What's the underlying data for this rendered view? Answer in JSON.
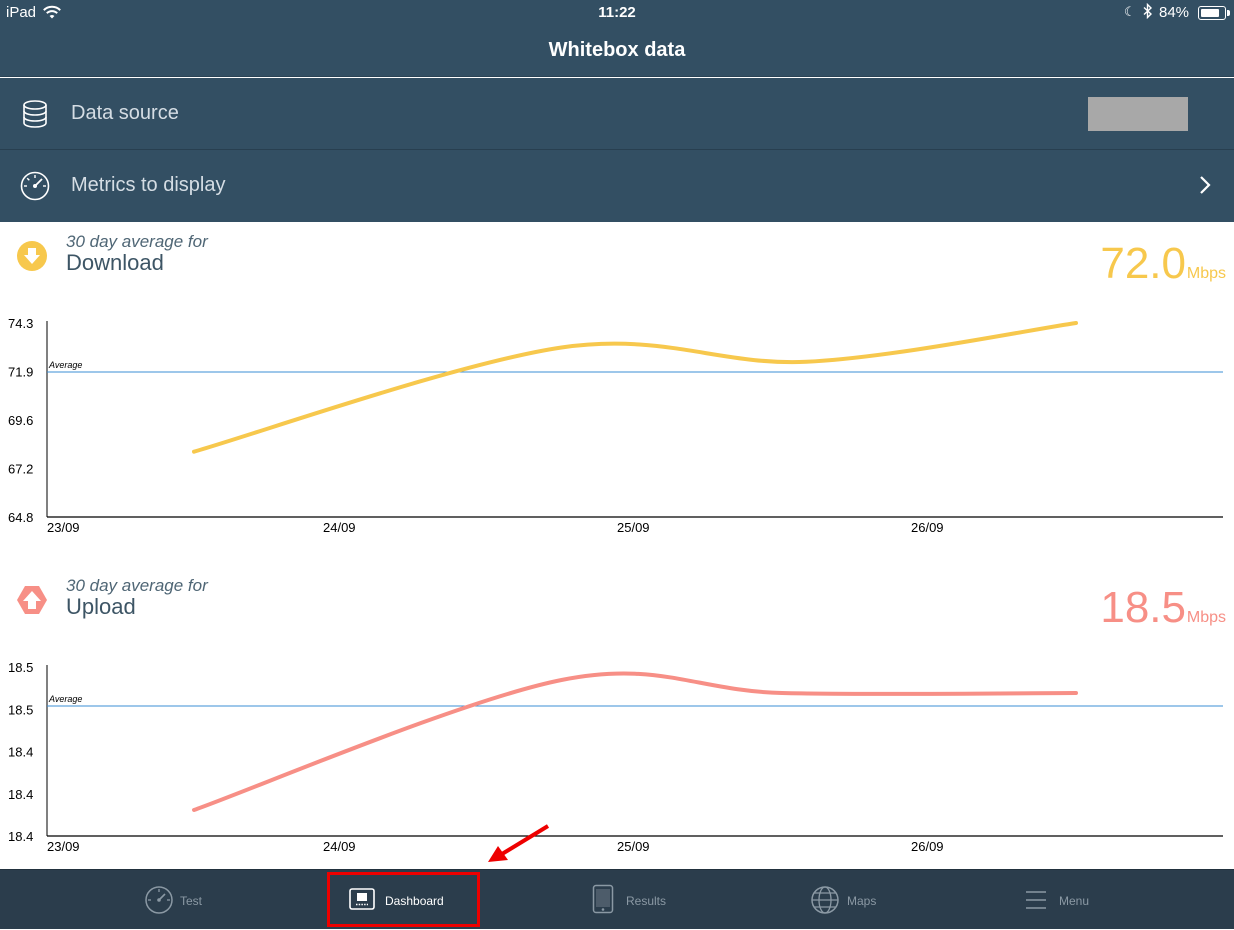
{
  "status_bar": {
    "carrier": "iPad",
    "time": "11:22",
    "battery_percent": "84%",
    "battery_level": 0.84,
    "icons": [
      "wifi-icon",
      "moon-icon",
      "bluetooth-icon",
      "battery-icon"
    ]
  },
  "nav": {
    "title": "Whitebox data"
  },
  "settings": {
    "data_source": {
      "label": "Data source",
      "icon": "database-icon",
      "value": ""
    },
    "metrics": {
      "label": "Metrics to display",
      "icon": "speedometer-icon",
      "chevron": "chevron-right-icon"
    }
  },
  "download": {
    "subtitle": "30 day average for",
    "name": "Download",
    "value": "72.0",
    "unit": "Mbps",
    "color": "#f7c84d",
    "icon": "download-arrow-icon"
  },
  "upload": {
    "subtitle": "30 day average for",
    "name": "Upload",
    "value": "18.5",
    "unit": "Mbps",
    "color": "#f78f86",
    "icon": "upload-arrow-icon"
  },
  "chart_data": [
    {
      "type": "line",
      "series": [
        {
          "x": [
            "23/09 12:00",
            "24/09 18:00",
            "25/09 14:00",
            "26/09 12:00"
          ],
          "values": [
            68.0,
            73.1,
            72.4,
            74.3
          ]
        }
      ],
      "x_ticks": [
        "23/09",
        "24/09",
        "25/09",
        "26/09"
      ],
      "y_ticks": [
        "74.3",
        "71.9",
        "69.6",
        "67.2",
        "64.8"
      ],
      "ylim": [
        64.8,
        74.3
      ],
      "average": 71.9,
      "average_label": "Average",
      "color": "#f7c84d",
      "grid": false
    },
    {
      "type": "line",
      "series": [
        {
          "x": [
            "23/09 12:00",
            "24/09 18:00",
            "25/09 12:00",
            "26/09 12:00"
          ],
          "values": [
            18.42,
            18.52,
            18.51,
            18.51
          ]
        }
      ],
      "x_ticks": [
        "23/09",
        "24/09",
        "25/09",
        "26/09"
      ],
      "y_ticks": [
        "18.5",
        "18.5",
        "18.4",
        "18.4",
        "18.4"
      ],
      "ylim": [
        18.4,
        18.53
      ],
      "average": 18.5,
      "average_label": "Average",
      "color": "#f78f86",
      "grid": false
    }
  ],
  "tabs": [
    {
      "label": "Test",
      "icon": "speedometer-icon",
      "active": false
    },
    {
      "label": "Dashboard",
      "icon": "dashboard-icon",
      "active": true
    },
    {
      "label": "Results",
      "icon": "tablet-icon",
      "active": false
    },
    {
      "label": "Maps",
      "icon": "globe-icon",
      "active": false
    },
    {
      "label": "Menu",
      "icon": "hamburger-icon",
      "active": false
    }
  ]
}
